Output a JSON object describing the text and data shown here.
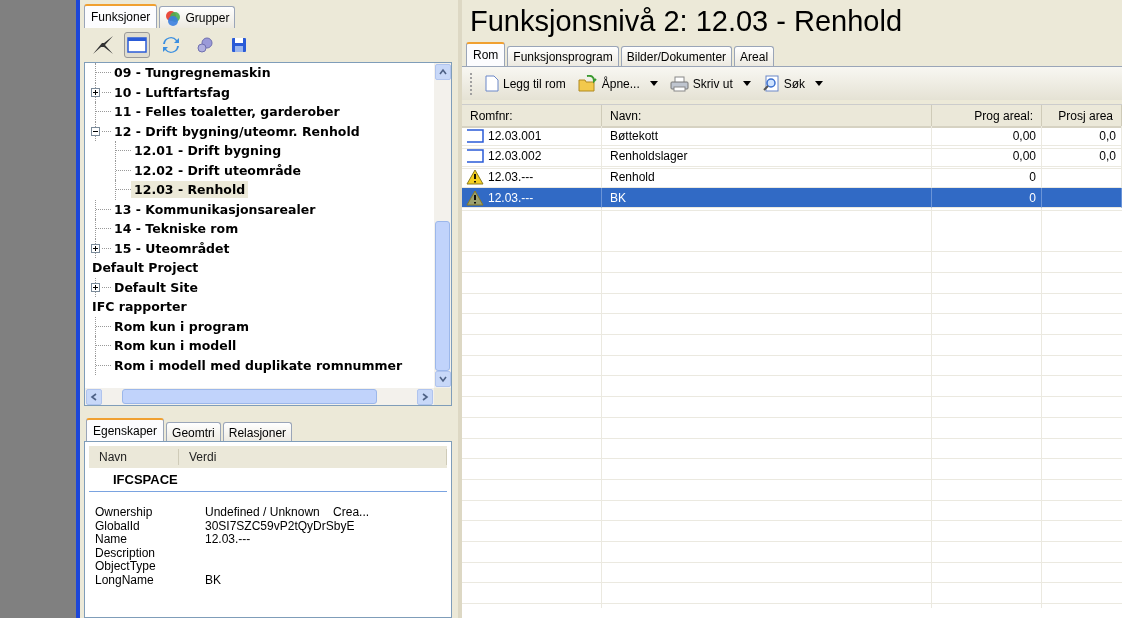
{
  "left_panel": {
    "tabs": [
      {
        "label": "Funksjoner",
        "selected": true,
        "icon": false
      },
      {
        "label": "Grupper",
        "selected": false,
        "icon": true
      }
    ],
    "toolbar": [
      {
        "kind": "collapse",
        "pressed": false
      },
      {
        "kind": "window",
        "pressed": true
      },
      {
        "kind": "refresh",
        "pressed": false
      },
      {
        "kind": "gears",
        "pressed": false
      },
      {
        "kind": "save",
        "pressed": false
      }
    ],
    "tree": {
      "partial_branch": [
        {
          "label": "09 - Tungregnemaskin",
          "selected": false
        },
        {
          "label": "10 - Luftfartsfag",
          "selected": false,
          "expanded": false
        },
        {
          "label": "11 - Felles toaletter, garderober",
          "selected": false
        },
        {
          "label": "12 - Drift bygning/uteomr. Renhold",
          "selected": false,
          "expanded": true,
          "children": [
            {
              "label": "12.01 - Drift bygning",
              "selected": false
            },
            {
              "label": "12.02 - Drift uteområde",
              "selected": false
            },
            {
              "label": "12.03 - Renhold",
              "selected": true
            }
          ]
        },
        {
          "label": "13 - Kommunikasjonsarealer",
          "selected": false
        },
        {
          "label": "14 - Tekniske rom",
          "selected": false
        },
        {
          "label": "15 - Uteområdet",
          "selected": false,
          "expanded": false
        }
      ],
      "roots": [
        {
          "label": "Default Project",
          "selected": false,
          "children": [
            {
              "label": "Default Site",
              "selected": false,
              "expanded": false
            }
          ]
        },
        {
          "label": "IFC rapporter",
          "selected": false,
          "children": [
            {
              "label": "Rom kun i program",
              "selected": false
            },
            {
              "label": "Rom kun i modell",
              "selected": false
            },
            {
              "label": "Rom i modell med duplikate romnummer",
              "selected": false
            }
          ]
        }
      ]
    },
    "property_tabs": [
      {
        "label": "Egenskaper",
        "selected": true
      },
      {
        "label": "Geomtri",
        "selected": false
      },
      {
        "label": "Relasjoner",
        "selected": false
      }
    ],
    "properties": {
      "columns": [
        "Navn",
        "Verdi"
      ],
      "group": "IFCSPACE",
      "rows": [
        {
          "name": "Ownership",
          "value": "Undefined / Unknown    Crea..."
        },
        {
          "name": "GlobalId",
          "value": "30SI7SZC59vP2tQyDrSbyE"
        },
        {
          "name": "Name",
          "value": "12.03.---"
        },
        {
          "name": "Description",
          "value": ""
        },
        {
          "name": "ObjectType",
          "value": ""
        },
        {
          "name": "LongName",
          "value": "BK"
        }
      ]
    }
  },
  "main": {
    "title": "Funksjonsnivå 2: 12.03 - Renhold",
    "tabs": [
      {
        "label": "Rom",
        "selected": true
      },
      {
        "label": "Funksjonsprogram",
        "selected": false
      },
      {
        "label": "Bilder/Dokumenter",
        "selected": false
      },
      {
        "label": "Areal",
        "selected": false
      }
    ],
    "toolbar": [
      {
        "kind": "new",
        "label": "Legg til rom",
        "dropdown": false
      },
      {
        "kind": "open",
        "label": "Åpne...",
        "dropdown": true
      },
      {
        "kind": "print",
        "label": "Skriv ut",
        "dropdown": true
      },
      {
        "kind": "search",
        "label": "Søk",
        "dropdown": true
      }
    ],
    "table": {
      "columns": [
        "Romfnr:",
        "Navn:",
        "Prog areal:",
        "Prosj area"
      ],
      "rows": [
        {
          "kind": "room",
          "selected": false,
          "cells": [
            "12.03.001",
            "Bøttekott",
            "0,00",
            "0,0"
          ]
        },
        {
          "kind": "room",
          "selected": false,
          "cells": [
            "12.03.002",
            "Renholdslager",
            "0,00",
            "0,0"
          ]
        },
        {
          "kind": "warning",
          "selected": false,
          "cells": [
            "12.03.---",
            "Renhold",
            "0",
            ""
          ]
        },
        {
          "kind": "warning",
          "selected": true,
          "cells": [
            "12.03.---",
            "BK",
            "0",
            ""
          ]
        }
      ]
    }
  }
}
